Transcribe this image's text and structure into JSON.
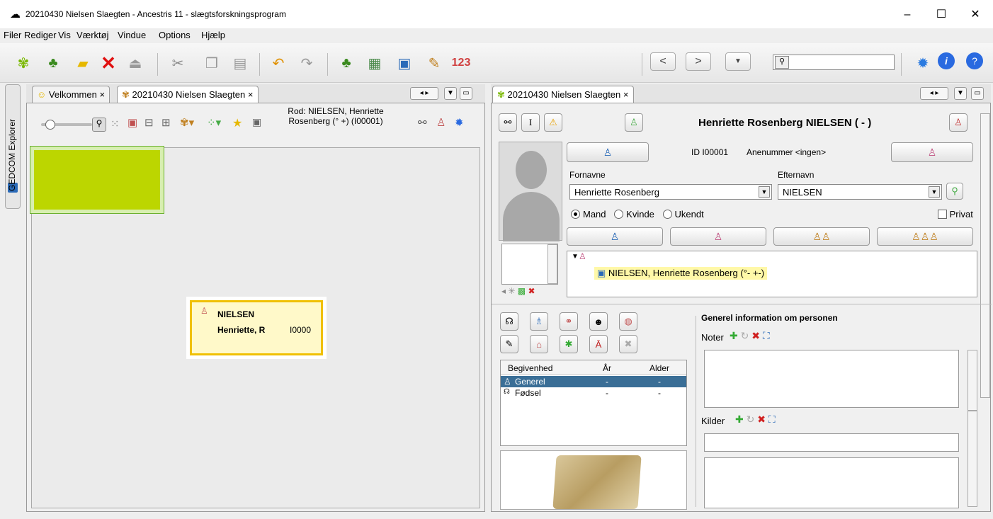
{
  "window": {
    "title": "20210430 Nielsen Slaegten - Ancestris 11 - slægtsforskningsprogram",
    "minimize": "–",
    "maximize": "☐",
    "close": "✕"
  },
  "menu": {
    "items": [
      "Filer",
      "Rediger",
      "Vis",
      "Værktøj",
      "Vindue",
      "Options",
      "Hjælp"
    ]
  },
  "toolbar": {
    "icons": [
      "new-tree-icon",
      "tree-icon",
      "open-folder-icon",
      "close-x-icon",
      "upload-icon",
      "cut-icon",
      "copy-icon",
      "paste-icon",
      "undo-icon",
      "redo-icon",
      "family-tree-icon",
      "calculator-icon",
      "address-book-icon",
      "edit-icon",
      "numbers-icon"
    ],
    "numbers_label": "123",
    "nav_back": "<",
    "nav_forward": ">",
    "search_value": ""
  },
  "side": {
    "explorer_label": "GEDCOM Explorer"
  },
  "left": {
    "tabs": [
      "Velkommen",
      "20210430 Nielsen Slaegten"
    ],
    "root_label": "Rod: NIELSEN, Henriette Rosenberg (° +) (I00001)",
    "card": {
      "surname": "NIELSEN",
      "given": "Henriette, R",
      "id": "I0000"
    },
    "colors": {
      "highlight_box": "#bcd600",
      "card_border": "#f0c000",
      "card_fill": "#fff9c9"
    }
  },
  "right": {
    "tab": "20210430 Nielsen Slaegten",
    "person_header": "Henriette Rosenberg NIELSEN ( - )",
    "id_line": "ID I00001",
    "anenummer": "Anenummer <ingen>",
    "fornavne_label": "Fornavne",
    "fornavne_value": "Henriette Rosenberg",
    "efternavn_label": "Efternavn",
    "efternavn_value": "NIELSEN",
    "sex_options": [
      "Mand",
      "Kvinde",
      "Ukendt"
    ],
    "sex_selected": "Mand",
    "privat_label": "Privat",
    "tree_entry": "NIELSEN, Henriette Rosenberg (°- +-)",
    "events": {
      "headers": [
        "Begivenhed",
        "År",
        "Alder"
      ],
      "rows": [
        {
          "name": "Generel",
          "year": "-",
          "age": "-"
        },
        {
          "name": "Fødsel",
          "year": "-",
          "age": "-"
        }
      ]
    },
    "info_title": "Generel information om personen",
    "noter_label": "Noter",
    "kilder_label": "Kilder"
  }
}
